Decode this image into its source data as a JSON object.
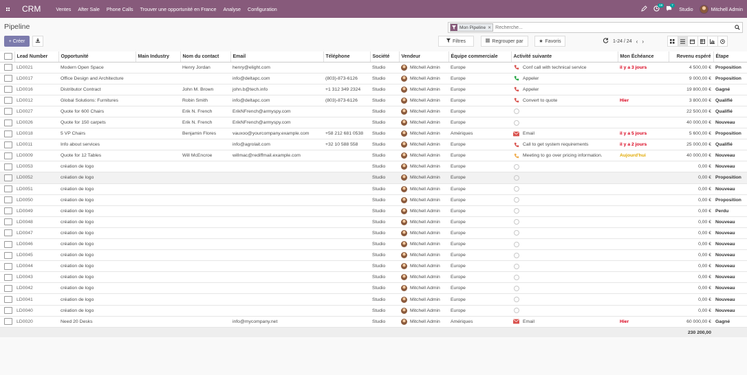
{
  "nav": {
    "brand": "CRM",
    "menu": [
      "Ventes",
      "After Sale",
      "Phone Calls",
      "Trouver une opportunité en France",
      "Analyse",
      "Configuration"
    ],
    "activity_count": "18",
    "message_count": "7",
    "studio": "Studio",
    "user": "Mitchell Admin"
  },
  "page": {
    "title": "Pipeline",
    "create_label": "Créer",
    "facet_label": "Mon Pipeline",
    "search_placeholder": "Recherche...",
    "filters_label": "Filtres",
    "groupby_label": "Regrouper par",
    "favorites_label": "Favoris",
    "pager": "1-24 / 24"
  },
  "columns": [
    "Lead Number",
    "Opportunité",
    "Main Industry",
    "Nom du contact",
    "Email",
    "Téléphone",
    "Société",
    "Vendeur",
    "Équipe commerciale",
    "Activité suivante",
    "Mon Échéance",
    "Revenu espéré",
    "Étape"
  ],
  "colors": {
    "brand": "#875a7b",
    "create_button": "#7c7bad",
    "overdue": "#d9001b",
    "today": "#e0a800",
    "phone_overdue": "#d9534f",
    "phone_ok": "#28a745",
    "phone_today": "#f0ad4e"
  },
  "rows": [
    {
      "num": "LD0021",
      "opp": "Modern Open Space",
      "industry": "",
      "contact": "Henry Jordan",
      "email": "henry@elight.com",
      "phone": "",
      "company": "Studio",
      "salesperson": "Mitchell Admin",
      "team": "Europe",
      "activity": "Conf call with technical service",
      "activity_icon": "phone-icon",
      "activity_state": "overdue",
      "deadline": "il y a 3 jours",
      "deadline_state": "overdue",
      "revenue": "4 500,00 €",
      "stage": "Proposition"
    },
    {
      "num": "LD0017",
      "opp": "Office Design and Architecture",
      "industry": "",
      "contact": "",
      "email": "info@deltapc.com",
      "phone": "(803)-873-6126",
      "company": "Studio",
      "salesperson": "Mitchell Admin",
      "team": "Europe",
      "activity": "Appeler",
      "activity_icon": "phone-icon",
      "activity_state": "planned",
      "deadline": "",
      "deadline_state": "",
      "revenue": "9 000,00 €",
      "stage": "Proposition"
    },
    {
      "num": "LD0016",
      "opp": "Distributor Contract",
      "industry": "",
      "contact": "John M. Brown",
      "email": "john.b@tech.info",
      "phone": "+1 312 349 2324",
      "company": "Studio",
      "salesperson": "Mitchell Admin",
      "team": "Europe",
      "activity": "Appeler",
      "activity_icon": "phone-icon",
      "activity_state": "overdue",
      "deadline": "",
      "deadline_state": "",
      "revenue": "19 800,00 €",
      "stage": "Gagné"
    },
    {
      "num": "LD0012",
      "opp": "Global Solutions: Furnitures",
      "industry": "",
      "contact": "Robin Smith",
      "email": "info@deltapc.com",
      "phone": "(803)-873-6126",
      "company": "Studio",
      "salesperson": "Mitchell Admin",
      "team": "Europe",
      "activity": "Convert to quote",
      "activity_icon": "phone-icon",
      "activity_state": "overdue",
      "deadline": "Hier",
      "deadline_state": "overdue",
      "revenue": "3 800,00 €",
      "stage": "Qualifié"
    },
    {
      "num": "LD0027",
      "opp": "Quote for 600 Chairs",
      "industry": "",
      "contact": "Erik N. French",
      "email": "ErikNFrench@armyspy.com",
      "phone": "",
      "company": "Studio",
      "salesperson": "Mitchell Admin",
      "team": "Europe",
      "activity": "",
      "activity_icon": "clock-icon",
      "activity_state": "none",
      "deadline": "",
      "deadline_state": "",
      "revenue": "22 500,00 €",
      "stage": "Qualifié"
    },
    {
      "num": "LD0026",
      "opp": "Quote for 150 carpets",
      "industry": "",
      "contact": "Erik N. French",
      "email": "ErikNFrench@armyspy.com",
      "phone": "",
      "company": "Studio",
      "salesperson": "Mitchell Admin",
      "team": "Europe",
      "activity": "",
      "activity_icon": "clock-icon",
      "activity_state": "none",
      "deadline": "",
      "deadline_state": "",
      "revenue": "40 000,00 €",
      "stage": "Nouveau"
    },
    {
      "num": "LD0018",
      "opp": "5 VP Chairs",
      "industry": "",
      "contact": "Benjamin Flores",
      "email": "vauxoo@yourcompany.example.com",
      "phone": "+58 212 681 0538",
      "company": "Studio",
      "salesperson": "Mitchell Admin",
      "team": "Amériques",
      "activity": "Email",
      "activity_icon": "email-icon",
      "activity_state": "overdue",
      "deadline": "il y a 5 jours",
      "deadline_state": "overdue",
      "revenue": "5 600,00 €",
      "stage": "Proposition"
    },
    {
      "num": "LD0011",
      "opp": "Info about services",
      "industry": "",
      "contact": "",
      "email": "info@agrolait.com",
      "phone": "+32 10 588 558",
      "company": "Studio",
      "salesperson": "Mitchell Admin",
      "team": "Europe",
      "activity": "Call to get system requirements",
      "activity_icon": "phone-icon",
      "activity_state": "overdue",
      "deadline": "il y a 2 jours",
      "deadline_state": "overdue",
      "revenue": "25 000,00 €",
      "stage": "Qualifié"
    },
    {
      "num": "LD0009",
      "opp": "Quote for 12 Tables",
      "industry": "",
      "contact": "Will McEncroe",
      "email": "willmac@rediffmail.example.com",
      "phone": "",
      "company": "Studio",
      "salesperson": "Mitchell Admin",
      "team": "Europe",
      "activity": "Meeting to go over pricing information.",
      "activity_icon": "phone-icon",
      "activity_state": "today",
      "deadline": "Aujourd'hui",
      "deadline_state": "today",
      "revenue": "40 000,00 €",
      "stage": "Nouveau"
    },
    {
      "num": "LD0053",
      "opp": "création de logo",
      "industry": "",
      "contact": "",
      "email": "",
      "phone": "",
      "company": "Studio",
      "salesperson": "Mitchell Admin",
      "team": "Europe",
      "activity": "",
      "activity_icon": "clock-icon",
      "activity_state": "none",
      "deadline": "",
      "deadline_state": "",
      "revenue": "0,00 €",
      "stage": "Nouveau"
    },
    {
      "num": "LD0052",
      "opp": "création de logo",
      "industry": "",
      "contact": "",
      "email": "",
      "phone": "",
      "company": "Studio",
      "salesperson": "Mitchell Admin",
      "team": "Europe",
      "activity": "",
      "activity_icon": "clock-icon",
      "activity_state": "none",
      "deadline": "",
      "deadline_state": "",
      "revenue": "0,00 €",
      "stage": "Proposition"
    },
    {
      "num": "LD0051",
      "opp": "création de logo",
      "industry": "",
      "contact": "",
      "email": "",
      "phone": "",
      "company": "Studio",
      "salesperson": "Mitchell Admin",
      "team": "Europe",
      "activity": "",
      "activity_icon": "clock-icon",
      "activity_state": "none",
      "deadline": "",
      "deadline_state": "",
      "revenue": "0,00 €",
      "stage": "Nouveau"
    },
    {
      "num": "LD0050",
      "opp": "création de logo",
      "industry": "",
      "contact": "",
      "email": "",
      "phone": "",
      "company": "Studio",
      "salesperson": "Mitchell Admin",
      "team": "Europe",
      "activity": "",
      "activity_icon": "clock-icon",
      "activity_state": "none",
      "deadline": "",
      "deadline_state": "",
      "revenue": "0,00 €",
      "stage": "Proposition"
    },
    {
      "num": "LD0049",
      "opp": "création de logo",
      "industry": "",
      "contact": "",
      "email": "",
      "phone": "",
      "company": "Studio",
      "salesperson": "Mitchell Admin",
      "team": "Europe",
      "activity": "",
      "activity_icon": "clock-icon",
      "activity_state": "none",
      "deadline": "",
      "deadline_state": "",
      "revenue": "0,00 €",
      "stage": "Perdu"
    },
    {
      "num": "LD0048",
      "opp": "création de logo",
      "industry": "",
      "contact": "",
      "email": "",
      "phone": "",
      "company": "Studio",
      "salesperson": "Mitchell Admin",
      "team": "Europe",
      "activity": "",
      "activity_icon": "clock-icon",
      "activity_state": "none",
      "deadline": "",
      "deadline_state": "",
      "revenue": "0,00 €",
      "stage": "Nouveau"
    },
    {
      "num": "LD0047",
      "opp": "création de logo",
      "industry": "",
      "contact": "",
      "email": "",
      "phone": "",
      "company": "Studio",
      "salesperson": "Mitchell Admin",
      "team": "Europe",
      "activity": "",
      "activity_icon": "clock-icon",
      "activity_state": "none",
      "deadline": "",
      "deadline_state": "",
      "revenue": "0,00 €",
      "stage": "Nouveau"
    },
    {
      "num": "LD0046",
      "opp": "création de logo",
      "industry": "",
      "contact": "",
      "email": "",
      "phone": "",
      "company": "Studio",
      "salesperson": "Mitchell Admin",
      "team": "Europe",
      "activity": "",
      "activity_icon": "clock-icon",
      "activity_state": "none",
      "deadline": "",
      "deadline_state": "",
      "revenue": "0,00 €",
      "stage": "Nouveau"
    },
    {
      "num": "LD0045",
      "opp": "création de logo",
      "industry": "",
      "contact": "",
      "email": "",
      "phone": "",
      "company": "Studio",
      "salesperson": "Mitchell Admin",
      "team": "Europe",
      "activity": "",
      "activity_icon": "clock-icon",
      "activity_state": "none",
      "deadline": "",
      "deadline_state": "",
      "revenue": "0,00 €",
      "stage": "Nouveau"
    },
    {
      "num": "LD0044",
      "opp": "création de logo",
      "industry": "",
      "contact": "",
      "email": "",
      "phone": "",
      "company": "Studio",
      "salesperson": "Mitchell Admin",
      "team": "Europe",
      "activity": "",
      "activity_icon": "clock-icon",
      "activity_state": "none",
      "deadline": "",
      "deadline_state": "",
      "revenue": "0,00 €",
      "stage": "Nouveau"
    },
    {
      "num": "LD0043",
      "opp": "création de logo",
      "industry": "",
      "contact": "",
      "email": "",
      "phone": "",
      "company": "Studio",
      "salesperson": "Mitchell Admin",
      "team": "Europe",
      "activity": "",
      "activity_icon": "clock-icon",
      "activity_state": "none",
      "deadline": "",
      "deadline_state": "",
      "revenue": "0,00 €",
      "stage": "Nouveau"
    },
    {
      "num": "LD0042",
      "opp": "création de logo",
      "industry": "",
      "contact": "",
      "email": "",
      "phone": "",
      "company": "Studio",
      "salesperson": "Mitchell Admin",
      "team": "Europe",
      "activity": "",
      "activity_icon": "clock-icon",
      "activity_state": "none",
      "deadline": "",
      "deadline_state": "",
      "revenue": "0,00 €",
      "stage": "Nouveau"
    },
    {
      "num": "LD0041",
      "opp": "création de logo",
      "industry": "",
      "contact": "",
      "email": "",
      "phone": "",
      "company": "Studio",
      "salesperson": "Mitchell Admin",
      "team": "Europe",
      "activity": "",
      "activity_icon": "clock-icon",
      "activity_state": "none",
      "deadline": "",
      "deadline_state": "",
      "revenue": "0,00 €",
      "stage": "Nouveau"
    },
    {
      "num": "LD0040",
      "opp": "création de logo",
      "industry": "",
      "contact": "",
      "email": "",
      "phone": "",
      "company": "Studio",
      "salesperson": "Mitchell Admin",
      "team": "Europe",
      "activity": "",
      "activity_icon": "clock-icon",
      "activity_state": "none",
      "deadline": "",
      "deadline_state": "",
      "revenue": "0,00 €",
      "stage": "Nouveau"
    },
    {
      "num": "LD0020",
      "opp": "Need 20 Desks",
      "industry": "",
      "contact": "",
      "email": "info@mycompany.net",
      "phone": "",
      "company": "Studio",
      "salesperson": "Mitchell Admin",
      "team": "Amériques",
      "activity": "Email",
      "activity_icon": "email-icon",
      "activity_state": "overdue",
      "deadline": "Hier",
      "deadline_state": "overdue",
      "revenue": "60 000,00 €",
      "stage": "Gagné"
    }
  ],
  "total_revenue": "230 200,00"
}
